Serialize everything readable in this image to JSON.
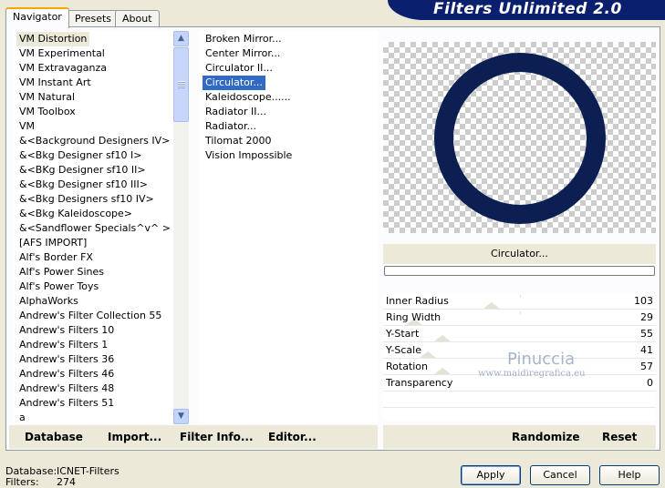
{
  "app_title": "Filters Unlimited 2.0",
  "tabs": [
    {
      "label": "Navigator",
      "active": true
    },
    {
      "label": "Presets",
      "active": false
    },
    {
      "label": "About",
      "active": false
    }
  ],
  "categories": {
    "selected": "VM Distortion",
    "items": [
      "VM Distortion",
      "VM Experimental",
      "VM Extravaganza",
      "VM Instant Art",
      "VM Natural",
      "VM Toolbox",
      "VM",
      "&<Background Designers IV>",
      "&<Bkg Designer sf10 I>",
      "&<BKg Designer sf10 II>",
      "&<Bkg Designer sf10 III>",
      "&<Bkg Designers sf10 IV>",
      "&<Bkg Kaleidoscope>",
      "&<Sandflower Specials^v^ >",
      "[AFS IMPORT]",
      "Alf's Border FX",
      "Alf's Power Sines",
      "Alf's Power Toys",
      "AlphaWorks",
      "Andrew's Filter Collection 55",
      "Andrew's Filters 10",
      "Andrew's Filters 1",
      "Andrew's Filters 36",
      "Andrew's Filters 46",
      "Andrew's Filters 48",
      "Andrew's Filters 51",
      "a"
    ]
  },
  "filters": {
    "selected": "Circulator...",
    "items": [
      "Broken Mirror...",
      "Center Mirror...",
      "Circulator II...",
      "Circulator...",
      "Kaleidoscope......",
      "Radiator II...",
      "Radiator...",
      "Tilomat 2000",
      "Vision Impossible"
    ]
  },
  "preview": {
    "ring_color": "#0c1f52",
    "filter_name": "Circulator..."
  },
  "parameters": [
    {
      "name": "Inner Radius",
      "value": "103",
      "level": 0.4
    },
    {
      "name": "Ring Width",
      "value": "29",
      "level": 0.11
    },
    {
      "name": "Y-Start",
      "value": "55",
      "level": 0.22
    },
    {
      "name": "Y-Scale",
      "value": "41",
      "level": 0.16
    },
    {
      "name": "Rotation",
      "value": "57",
      "level": 0.22
    },
    {
      "name": "Transparency",
      "value": "0",
      "level": 0
    }
  ],
  "watermark": {
    "name": "Pinuccia",
    "site": "www.maidiregrafica.eu"
  },
  "left_buttons": {
    "database": "Database",
    "import": "Import...",
    "filter_info": "Filter Info...",
    "editor": "Editor..."
  },
  "right_buttons": {
    "randomize": "Randomize",
    "reset": "Reset"
  },
  "status": {
    "database_label": "Database:",
    "database_value": "ICNET-Filters",
    "filters_label": "Filters:",
    "filters_value": "274"
  },
  "dialog_buttons": {
    "apply": "Apply",
    "cancel": "Cancel",
    "help": "Help"
  },
  "colors": {
    "accent": "#0b1f6f",
    "selection": "#316ac5",
    "dialog_bg": "#ece9d8"
  }
}
